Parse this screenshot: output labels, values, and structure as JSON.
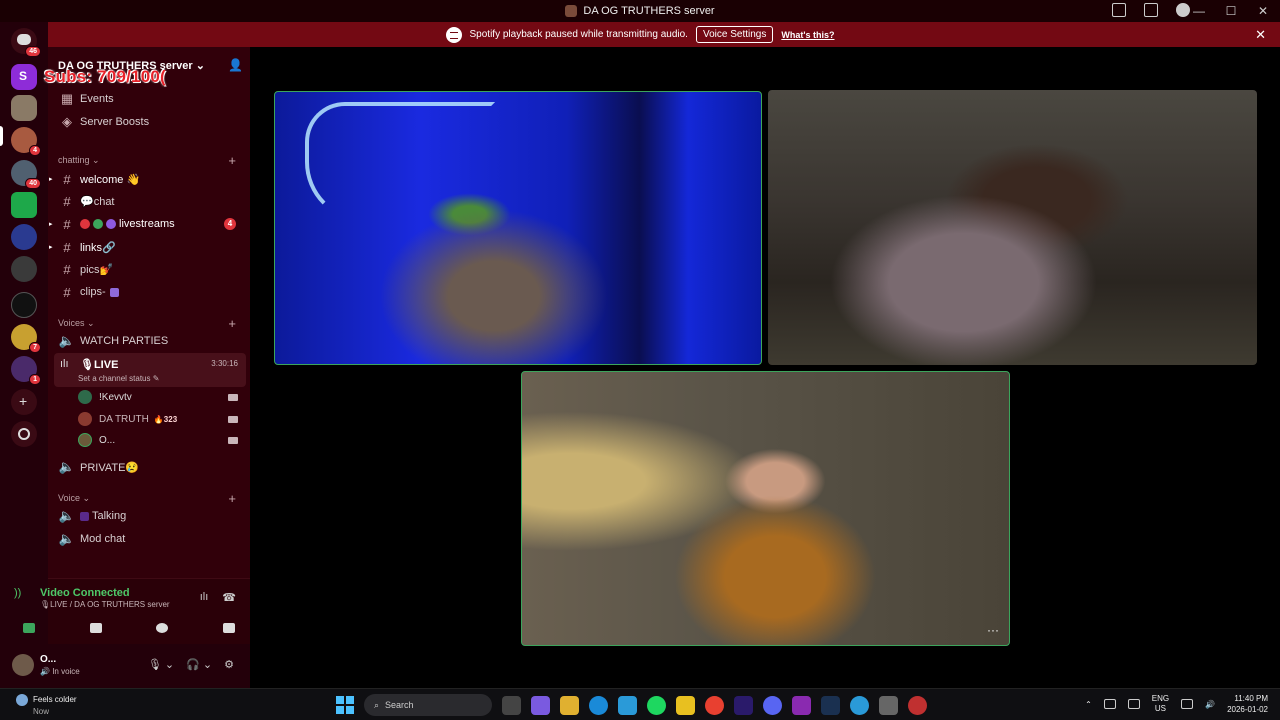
{
  "window": {
    "title": "DA OG TRUTHERS server"
  },
  "notice": {
    "text": "Spotify playback paused while transmitting audio.",
    "button": "Voice Settings",
    "link": "What's this?"
  },
  "rail": {
    "home_badge": "46",
    "items": [
      {
        "name": "server-s",
        "color": "#8e2cd8",
        "badge": ""
      },
      {
        "name": "server-a",
        "color": "#8a7a66",
        "badge": ""
      },
      {
        "name": "server-b",
        "color": "#a85a40",
        "badge": "4"
      },
      {
        "name": "server-c",
        "color": "#506070",
        "badge": "40"
      },
      {
        "name": "server-d",
        "color": "#1ea84a",
        "badge": ""
      },
      {
        "name": "server-e",
        "color": "#2a3a90",
        "badge": ""
      },
      {
        "name": "server-f",
        "color": "#3a3a3a",
        "badge": ""
      },
      {
        "name": "server-g",
        "color": "#111",
        "badge": ""
      },
      {
        "name": "server-h",
        "color": "#c8a030",
        "badge": "7"
      },
      {
        "name": "server-i",
        "color": "#4a2a6a",
        "badge": "1"
      }
    ]
  },
  "server": {
    "name": "DA OG TRUTHERS server",
    "subs_overlay": "Subs: 709/100("
  },
  "sidebar": {
    "top_items": [
      "Events",
      "Server Boosts"
    ],
    "cat_chatting": "chatting",
    "channels_chatting": [
      {
        "label": "welcome 👋"
      },
      {
        "label": "💬chat"
      },
      {
        "label": "livestreams",
        "count": "4"
      },
      {
        "label": "links🔗"
      },
      {
        "label": "pics💅"
      },
      {
        "label": "clips-"
      }
    ],
    "cat_voices": "Voices",
    "watch_parties": "WATCH PARTIES",
    "live": {
      "name": "🎙LIVE",
      "status": "Set a channel status ✎",
      "timer": "3:30:16",
      "members": [
        {
          "name": "!Kevvtv",
          "extra": "",
          "color": "#2e6a4a"
        },
        {
          "name": "DA TRUTH",
          "extra": "🔥323",
          "color": "#8a3a30"
        },
        {
          "name": "O...",
          "extra": "",
          "color": "#6a5a3a"
        }
      ]
    },
    "private": "PRIVATE😢",
    "cat_voice": "Voice",
    "voice_channels": [
      "Talking",
      "Mod chat"
    ]
  },
  "voice_panel": {
    "connected": "Video Connected",
    "location": "🎙LIVE / DA OG TRUTHERS server"
  },
  "user": {
    "name": "O...",
    "status": "In voice"
  },
  "taskbar": {
    "weather": "Feels colder",
    "weather_sub": "Now",
    "weather_badge": "3",
    "search": "Search",
    "lang_top": "ENG",
    "lang_bottom": "US",
    "time": "11:40 PM",
    "date": "2026-01-02"
  },
  "colors": {
    "accent_red": "#730913",
    "sidebar_bg": "#31000a",
    "speaking_green": "#3ca55c"
  }
}
